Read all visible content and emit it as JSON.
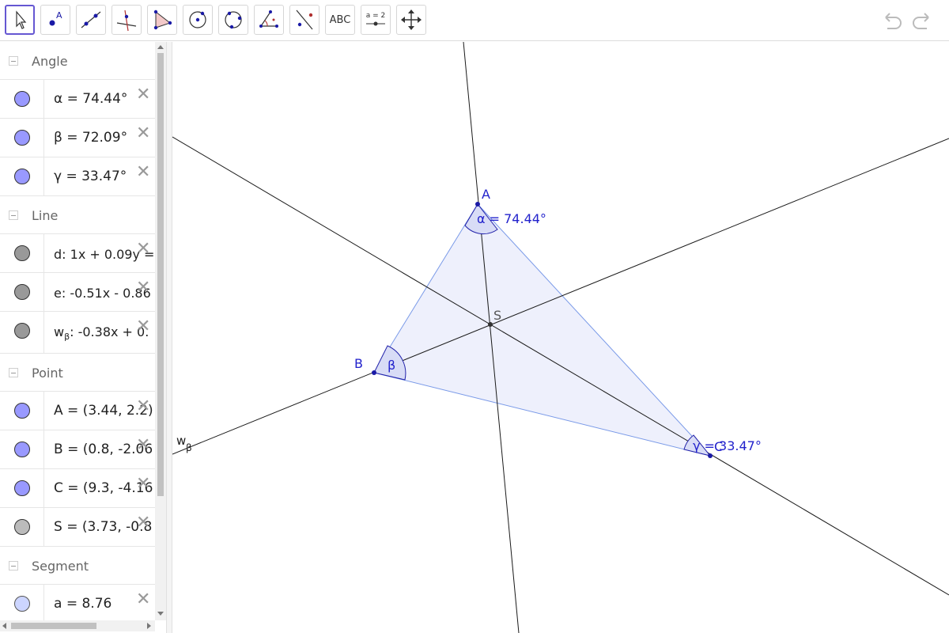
{
  "toolbar": {
    "tools": [
      {
        "name": "move-tool",
        "label": ""
      },
      {
        "name": "point-tool",
        "label": ""
      },
      {
        "name": "line-tool",
        "label": ""
      },
      {
        "name": "perpendicular-line-tool",
        "label": ""
      },
      {
        "name": "polygon-tool",
        "label": ""
      },
      {
        "name": "circle-center-point-tool",
        "label": ""
      },
      {
        "name": "circle-three-points-tool",
        "label": ""
      },
      {
        "name": "angle-tool",
        "label": ""
      },
      {
        "name": "reflect-tool",
        "label": ""
      },
      {
        "name": "text-tool",
        "label": "ABC"
      },
      {
        "name": "slider-tool",
        "label": "a = 2"
      },
      {
        "name": "move-graphics-tool",
        "label": ""
      }
    ]
  },
  "algebra": {
    "groups": [
      {
        "name": "Angle",
        "items": [
          {
            "expr": "α = 74.44°",
            "color": "#9999ff"
          },
          {
            "expr": "β = 72.09°",
            "color": "#9999ff"
          },
          {
            "expr": "γ = 33.47°",
            "color": "#9999ff"
          }
        ]
      },
      {
        "name": "Line",
        "items": [
          {
            "expr": "d: 1x + 0.09y = ",
            "color": "#999999"
          },
          {
            "expr": "e: -0.51x - 0.86",
            "color": "#999999"
          },
          {
            "expr_main": "w",
            "expr_sub": "β",
            "expr_rest": ": -0.38x + 0.",
            "color": "#999999"
          }
        ]
      },
      {
        "name": "Point",
        "items": [
          {
            "expr": "A = (3.44, 2.2)",
            "color": "#9999ff"
          },
          {
            "expr": "B = (0.8, -2.06",
            "color": "#9999ff"
          },
          {
            "expr": "C = (9.3, -4.16",
            "color": "#9999ff"
          },
          {
            "expr": "S = (3.73, -0.8",
            "color": "#bbbbbb"
          }
        ]
      },
      {
        "name": "Segment",
        "items": [
          {
            "expr": "a = 8.76",
            "color": "#ccd5ff"
          }
        ]
      }
    ]
  },
  "graphics": {
    "labels": {
      "A": "A",
      "B": "B",
      "C": "C",
      "S": "S",
      "alpha": "α = 74.44°",
      "beta": "β",
      "gamma": "γ = 33.47°",
      "w_main": "w",
      "w_sub": "β"
    },
    "colors": {
      "polygon_fill": "#eef0fc",
      "polygon_stroke": "#7a9ae8",
      "point": "#1a1aa6",
      "label": "#2222cc",
      "line": "#1a1a1a"
    }
  }
}
